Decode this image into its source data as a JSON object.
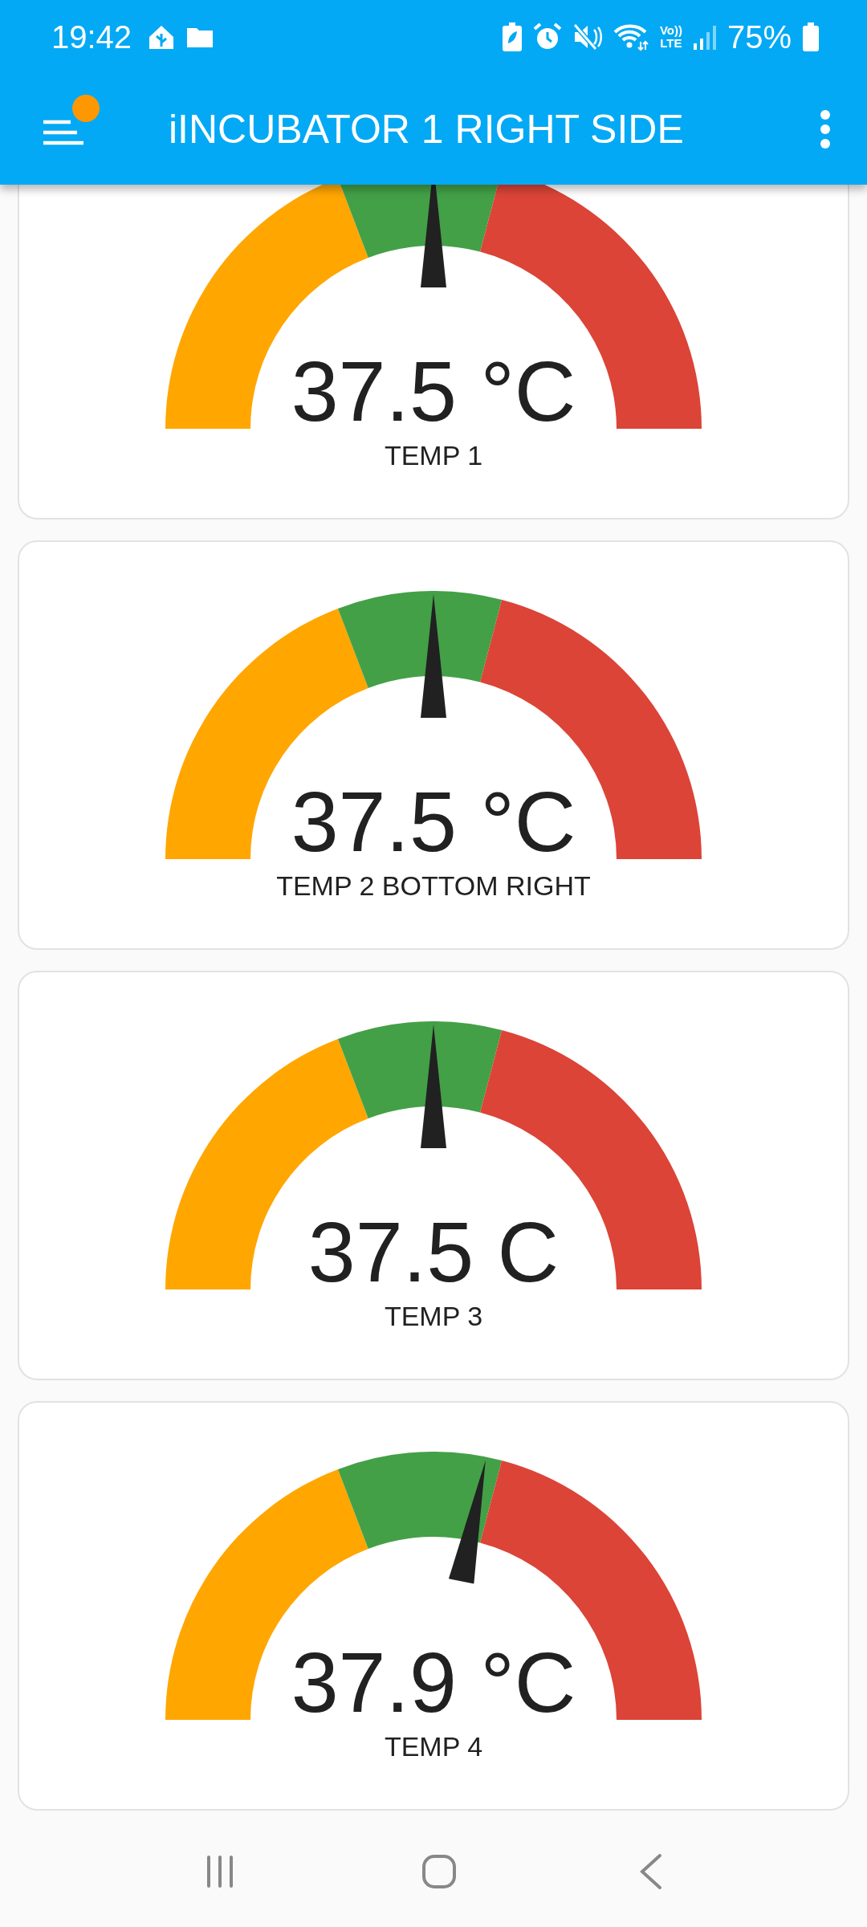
{
  "status_bar": {
    "time": "19:42",
    "volte": [
      "Vo))",
      "LTE"
    ],
    "battery": "75%"
  },
  "header": {
    "title": "iINCUBATOR 1 RIGHT SIDE",
    "menu_badge": true
  },
  "gauges": [
    {
      "value": "37.5 °C",
      "label": "TEMP 1"
    },
    {
      "value": "37.5 °C",
      "label": "TEMP 2 BOTTOM RIGHT"
    },
    {
      "value": "37.5 C",
      "label": "TEMP 3"
    },
    {
      "value": "37.9 °C",
      "label": "TEMP 4"
    }
  ]
}
